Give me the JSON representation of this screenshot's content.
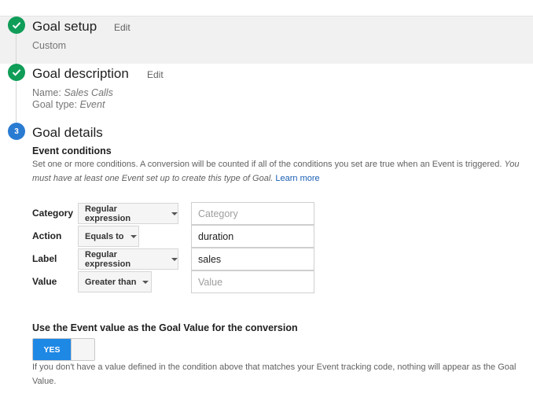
{
  "steps": [
    {
      "title": "Goal setup",
      "edit_label": "Edit",
      "summary": "Custom"
    },
    {
      "title": "Goal description",
      "edit_label": "Edit",
      "name_label": "Name:",
      "name_value": "Sales Calls",
      "type_label": "Goal type:",
      "type_value": "Event"
    },
    {
      "number": "3",
      "title": "Goal details"
    }
  ],
  "event_conditions": {
    "heading": "Event conditions",
    "description": "Set one or more conditions. A conversion will be counted if all of the conditions you set are true when an Event is triggered.",
    "description_italic": "You must have at least one Event set up to create this type of Goal.",
    "learn_more": "Learn more",
    "rows": [
      {
        "label": "Category",
        "match": "Regular expression",
        "value": "",
        "placeholder": "Category"
      },
      {
        "label": "Action",
        "match": "Equals to",
        "value": "duration",
        "placeholder": ""
      },
      {
        "label": "Label",
        "match": "Regular expression",
        "value": "sales",
        "placeholder": ""
      },
      {
        "label": "Value",
        "match": "Greater than",
        "value": "",
        "placeholder": "Value"
      }
    ]
  },
  "goal_value": {
    "heading": "Use the Event value as the Goal Value for the conversion",
    "toggle_label": "YES",
    "toggle_on": true,
    "note": "If you don't have a value defined in the condition above that matches your Event tracking code, nothing will appear as the Goal Value."
  },
  "colors": {
    "done": "#0f9d58",
    "step_number": "#2a7bd2",
    "toggle_on": "#1e88e5",
    "link": "#1a5fb4"
  }
}
